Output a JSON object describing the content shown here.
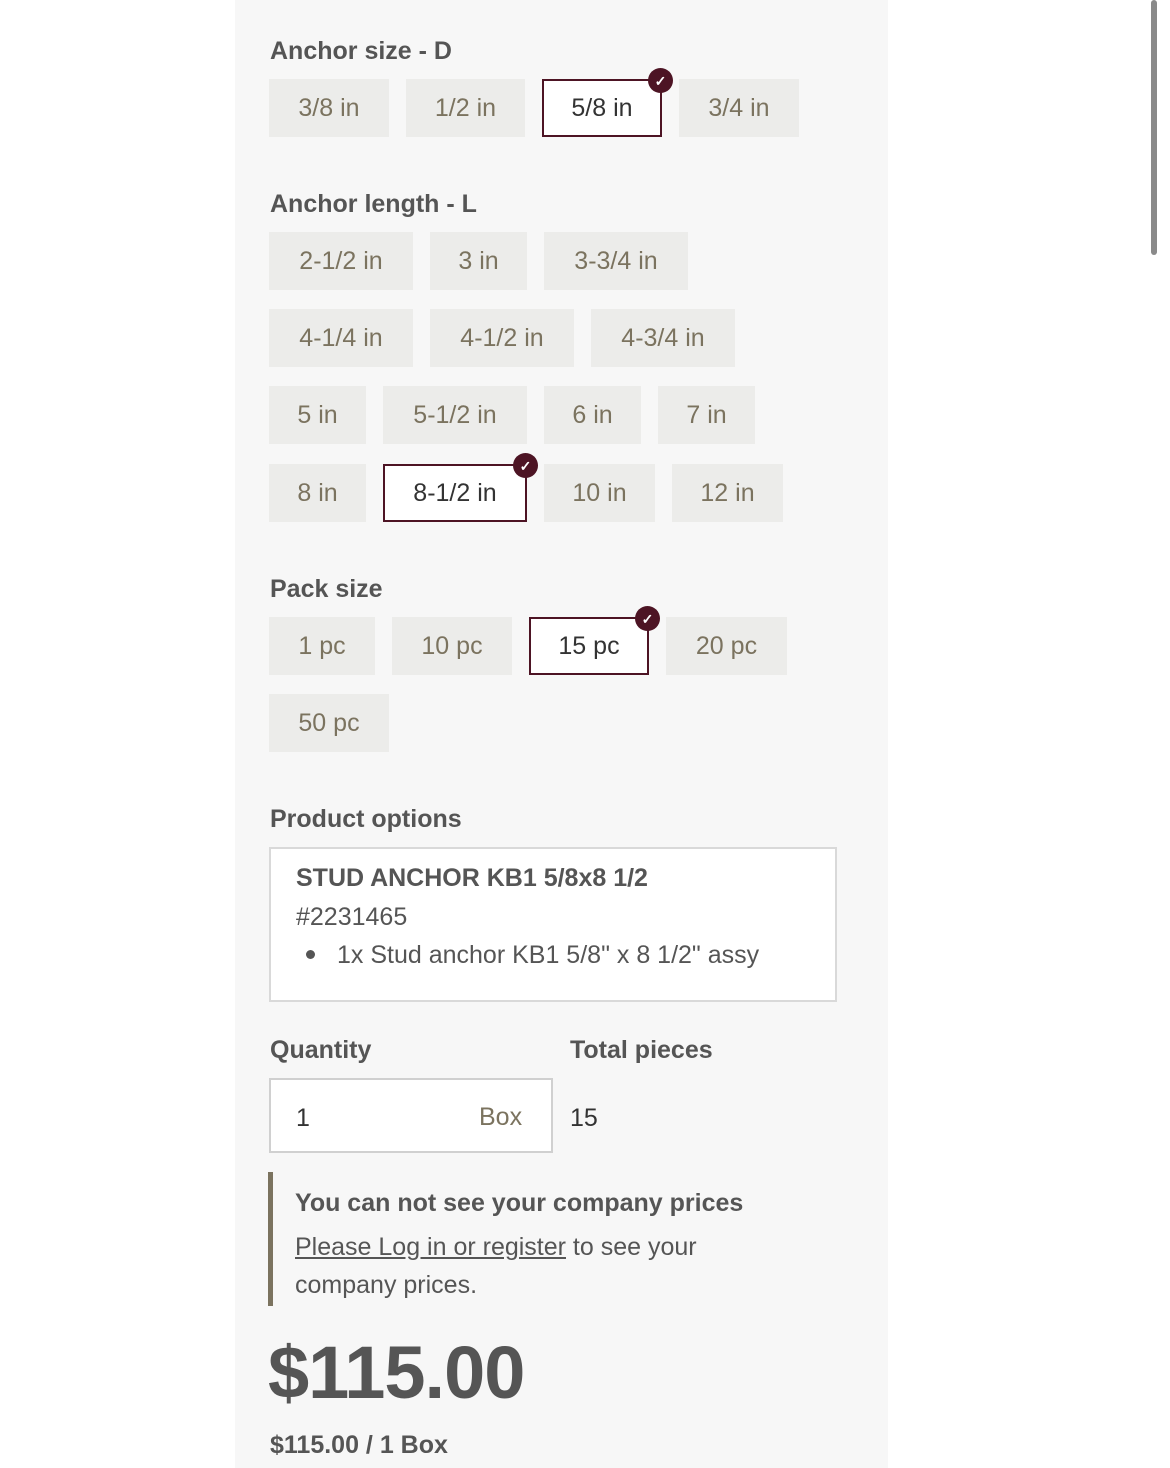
{
  "anchor_size": {
    "label": "Anchor size - D",
    "options": [
      "3/8 in",
      "1/2 in",
      "5/8 in",
      "3/4 in"
    ],
    "selected": "5/8 in"
  },
  "anchor_length": {
    "label": "Anchor length - L",
    "options": [
      "2-1/2 in",
      "3 in",
      "3-3/4 in",
      "4-1/4 in",
      "4-1/2 in",
      "4-3/4 in",
      "5 in",
      "5-1/2 in",
      "6 in",
      "7 in",
      "8 in",
      "8-1/2 in",
      "10 in",
      "12 in"
    ],
    "selected": "8-1/2 in"
  },
  "pack_size": {
    "label": "Pack size",
    "options": [
      "1 pc",
      "10 pc",
      "15 pc",
      "20 pc",
      "50 pc"
    ],
    "selected": "15 pc"
  },
  "product_options": {
    "label": "Product options",
    "title": "STUD ANCHOR KB1 5/8x8 1/2",
    "sku": "#2231465",
    "items": [
      "1x Stud anchor KB1 5/8\" x 8 1/2\" assy"
    ]
  },
  "quantity": {
    "label": "Quantity",
    "value": "1",
    "unit": "Box"
  },
  "total_pieces": {
    "label": "Total pieces",
    "value": "15"
  },
  "notice": {
    "title": "You can not see your company prices",
    "link_text": "Please Log in or register",
    "text_after": " to see your company prices."
  },
  "price": {
    "total": "$115.00",
    "per_unit": "$115.00 / 1 Box"
  },
  "colors": {
    "accent": "#4d1424",
    "chip_bg": "#ececea",
    "chip_text": "#7b735f",
    "panel_bg": "#f7f7f7"
  }
}
